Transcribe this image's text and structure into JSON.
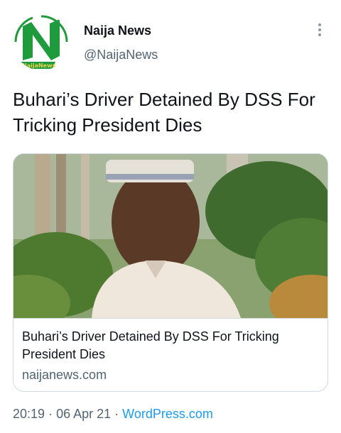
{
  "account": {
    "name": "Naija News",
    "handle": "@NaijaNews",
    "avatar_icon": "naija-news-logo-icon",
    "logo_text": "NaijaNews"
  },
  "tweet": {
    "text": "Buhari’s Driver Detained By DSS For Tricking President Dies"
  },
  "card": {
    "title": "Buhari’s Driver Detained By DSS For Tricking President Dies",
    "domain": "naijanews.com",
    "image_icon": "article-photo"
  },
  "meta": {
    "time": "20:19",
    "separator": "·",
    "date": "06 Apr 21",
    "source": "WordPress.com"
  },
  "colors": {
    "text": "#0f1419",
    "secondary": "#536471",
    "link": "#1d9bf0",
    "border": "#cfd9de",
    "logo_green": "#1f9a3c"
  },
  "icons": {
    "more": "more-vertical-icon"
  }
}
